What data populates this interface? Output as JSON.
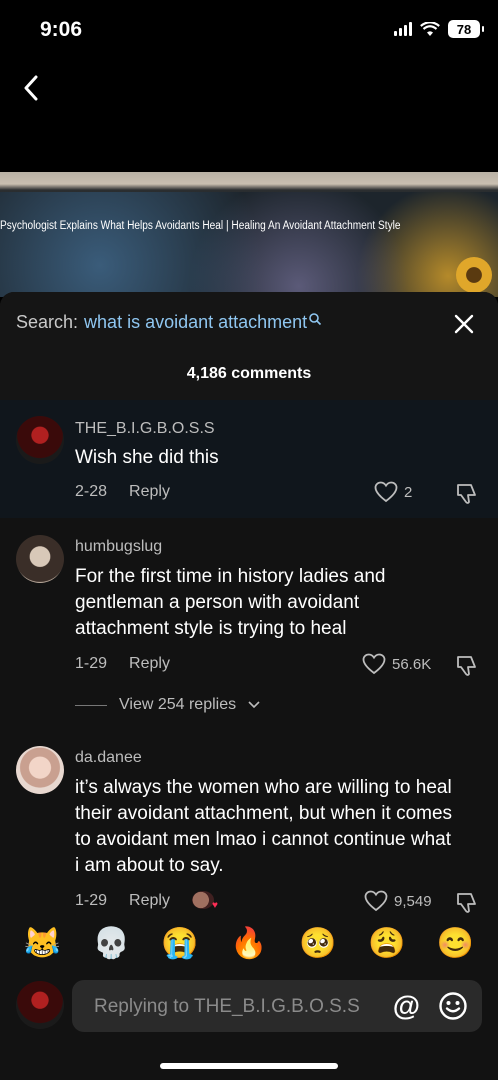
{
  "status": {
    "time": "9:06",
    "battery": "78"
  },
  "video": {
    "title": "Psychologist Explains What Helps Avoidants Heal | Healing An Avoidant Attachment Style"
  },
  "sheet": {
    "search_prefix": "Search:",
    "search_query": "what is avoidant attachment",
    "comments_count": "4,186 comments"
  },
  "comments": [
    {
      "username": "THE_B.I.G.B.O.S.S",
      "text": "Wish she did this",
      "date": "2-28",
      "reply_label": "Reply",
      "likes": "2"
    },
    {
      "username": "humbugslug",
      "text": "For the first time in history ladies and gentleman a person with avoidant attachment style is trying to heal",
      "date": "1-29",
      "reply_label": "Reply",
      "likes": "56.6K",
      "view_replies": "View 254 replies"
    },
    {
      "username": "da.danee",
      "text": "it’s always the women who are willing to heal their avoidant attachment, but when it comes to avoidant men lmao i cannot continue what i am about to say.",
      "date": "1-29",
      "reply_label": "Reply",
      "likes": "9,549"
    }
  ],
  "emoji_bar": [
    "😹",
    "💀",
    "😭",
    "🔥",
    "🥺",
    "😩",
    "😊"
  ],
  "reply_bar": {
    "placeholder": "Replying to THE_B.I.G.B.O.S.S",
    "at_symbol": "@"
  },
  "colors": {
    "accent_link": "#8fc6f0",
    "sheet_bg": "#121212",
    "highlight_bg": "#10161c"
  }
}
